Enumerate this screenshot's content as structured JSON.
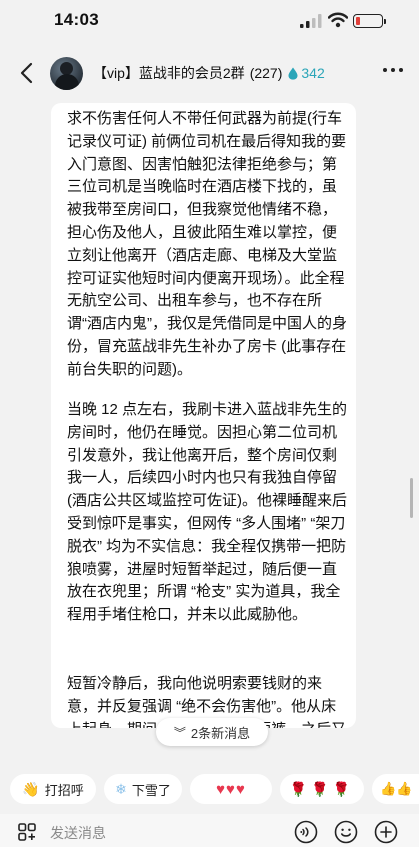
{
  "status_bar": {
    "time": "14:03"
  },
  "header": {
    "title": "【vip】蓝战非的会员2群",
    "member_count": "(227)",
    "fire_count": "342"
  },
  "message": {
    "paragraphs": [
      "求不伤害任何人不带任何武器为前提(行车记录仪可证) 前俩位司机在最后得知我的要入门意图、因害怕触犯法律拒绝参与；第三位司机是当晚临时在酒店楼下找的，虽被我带至房间口，但我察觉他情绪不稳，担心伤及他人，且彼此陌生难以掌控，便立刻让他离开（酒店走廊、电梯及大堂监控可证实他短时间内便离开现场）。此全程无航空公司、出租车参与，也不存在所谓“酒店内鬼”，我仅是凭借同是中国人的身份，冒充蓝战非先生补办了房卡 (此事存在前台失职的问题)。",
      "当晚 12 点左右，我刷卡进入蓝战非先生的房间时，他仍在睡觉。因担心第二位司机引发意外，我让他离开后，整个房间仅剩我一人，后续四小时内也只有我独自停留 (酒店公共区域监控可佐证)。他裸睡醒来后受到惊吓是事实，但网传 “多人围堵” “架刀脱衣” 均为不实信息：我全程仅携带一把防狼喷雾，进屋时短暂举起过，随后便一直放在衣兜里；所谓 “枪支” 实为道具，我全程用手堵住枪口，并未以此威胁他。",
      "短暂冷静后，我向他说明索要钱财的来意，并反复强调 “绝不会伤害他”。他从床上起身，期间自行换上T恤和短裤，之后又更换坐姿，全程没有下场，我则一直坐在床尾"
    ]
  },
  "new_messages_pill": "2条新消息",
  "quick_replies": [
    {
      "icon": "wave-hand-icon",
      "glyph": "👋",
      "label": "打招呼"
    },
    {
      "icon": "snowflake-icon",
      "glyph": "❄",
      "label": "下雪了"
    },
    {
      "icon": "hearts-icon",
      "glyph": "",
      "label": "♥♥♥"
    },
    {
      "icon": "roses-icon",
      "glyph": "",
      "label": "🌹🌹🌹"
    },
    {
      "icon": "thumbs-up-icon",
      "glyph": "👍👍",
      "label": ""
    }
  ],
  "input": {
    "placeholder": "发送消息"
  },
  "colors": {
    "accent": "#2aa5b8",
    "bubble": "#ffffff",
    "background": "#f2f2f2",
    "battery_low": "#e0403a"
  }
}
